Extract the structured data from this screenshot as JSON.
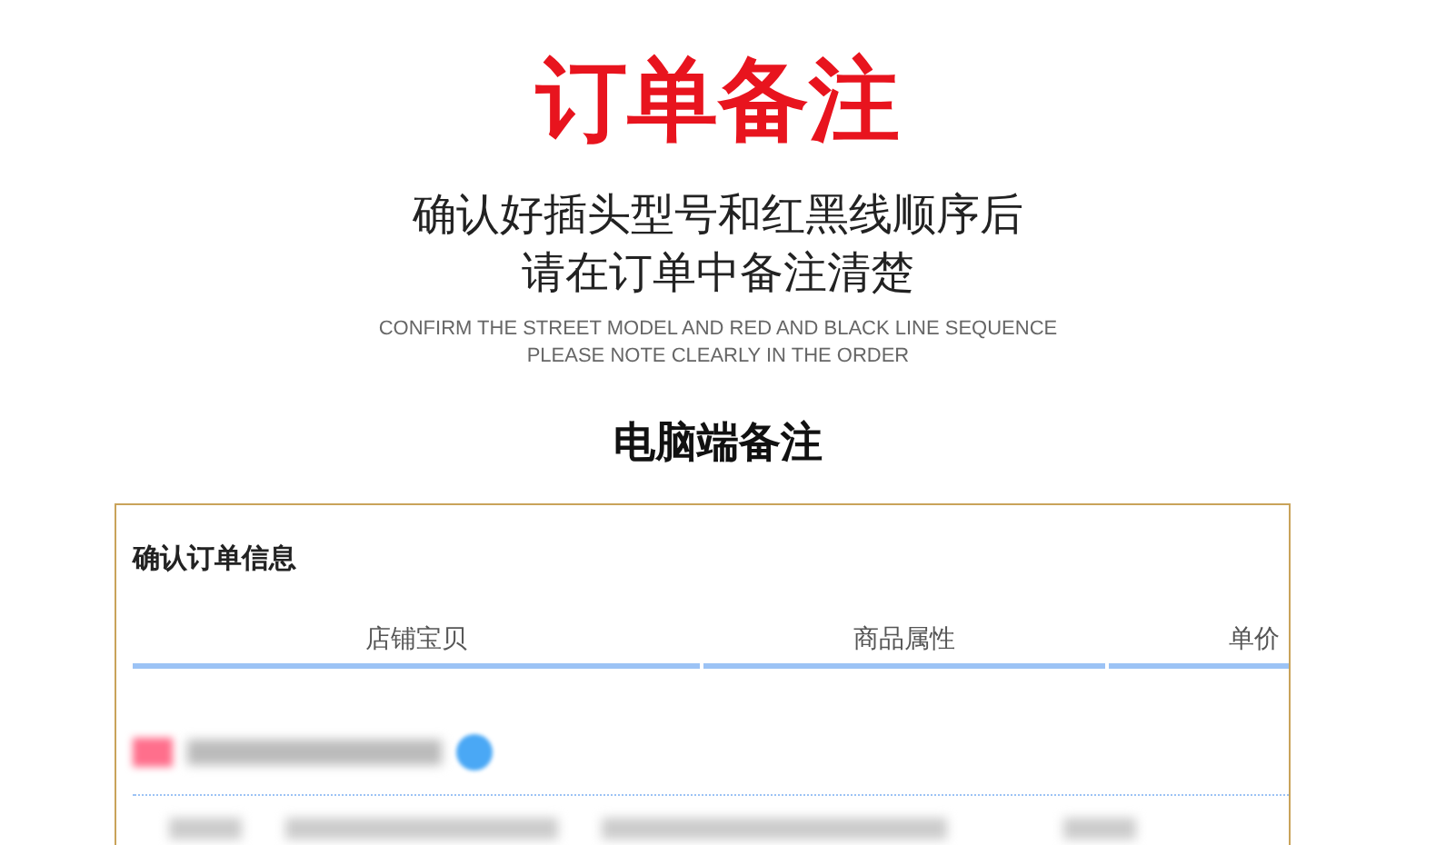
{
  "title": "订单备注",
  "subtitle_lines": [
    "确认好插头型号和红黑线顺序后",
    "请在订单中备注清楚"
  ],
  "english_lines": [
    "CONFIRM THE STREET MODEL AND RED AND BLACK LINE SEQUENCE",
    "PLEASE NOTE CLEARLY IN THE ORDER"
  ],
  "section_heading": "电脑端备注",
  "order_panel": {
    "title": "确认订单信息",
    "columns": [
      "店铺宝贝",
      "商品属性",
      "单价"
    ]
  }
}
